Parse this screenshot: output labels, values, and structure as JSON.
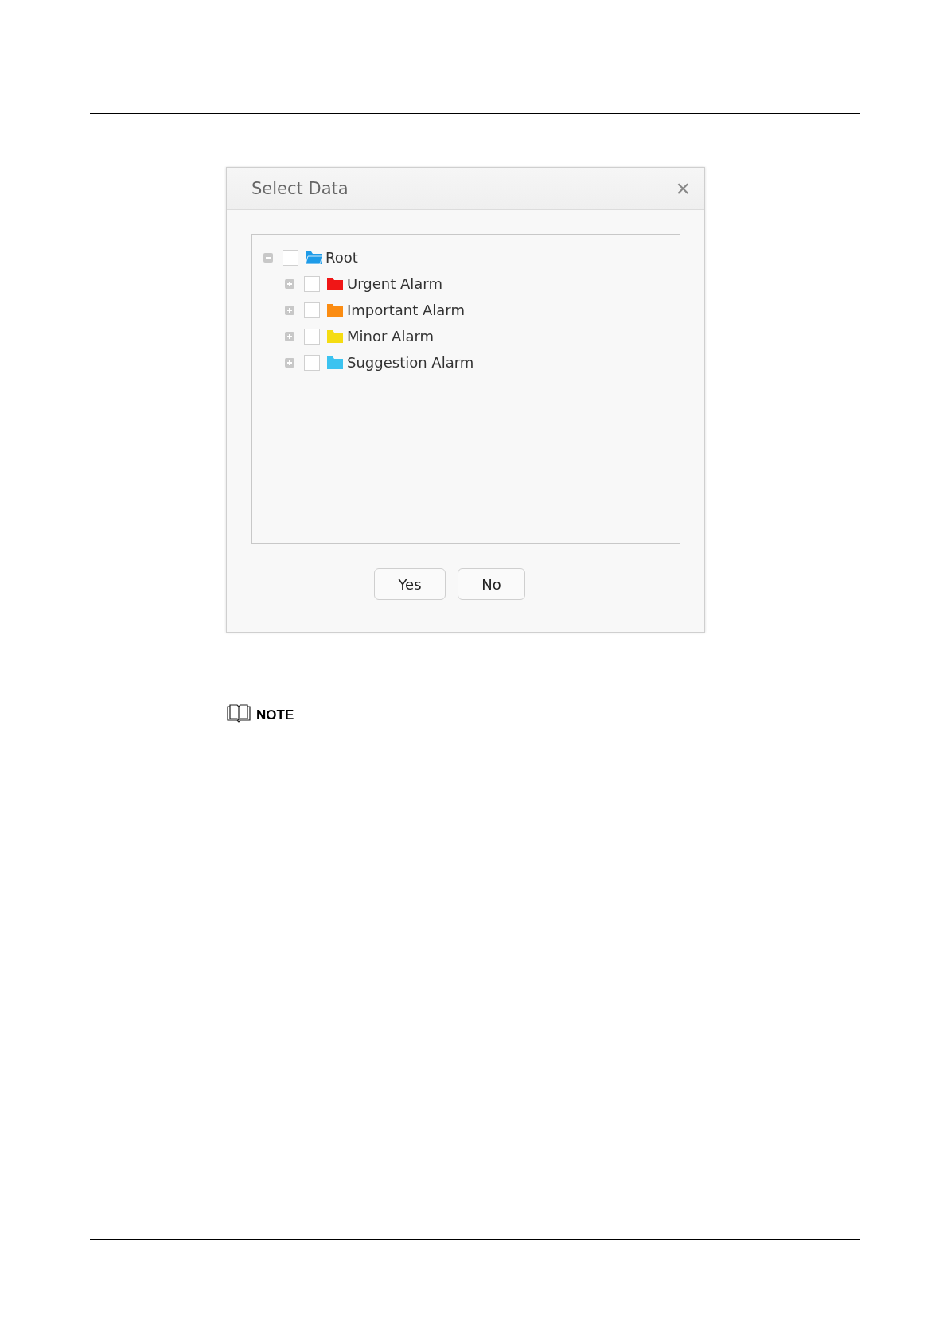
{
  "dialog": {
    "title": "Select Data",
    "close": "×",
    "tree": [
      {
        "label": "Root",
        "checked": false,
        "expanded": true,
        "color": "#1e9be8",
        "children": [
          {
            "label": "Urgent Alarm",
            "checked": false,
            "expanded": false,
            "color": "#f01616"
          },
          {
            "label": "Important Alarm",
            "checked": false,
            "expanded": false,
            "color": "#fb8c12"
          },
          {
            "label": "Minor Alarm",
            "checked": false,
            "expanded": false,
            "color": "#f5dc12"
          },
          {
            "label": "Suggestion Alarm",
            "checked": false,
            "expanded": false,
            "color": "#3cc3f0"
          }
        ]
      }
    ],
    "buttons": [
      "Yes",
      "No"
    ]
  },
  "note": {
    "label": "NOTE"
  }
}
